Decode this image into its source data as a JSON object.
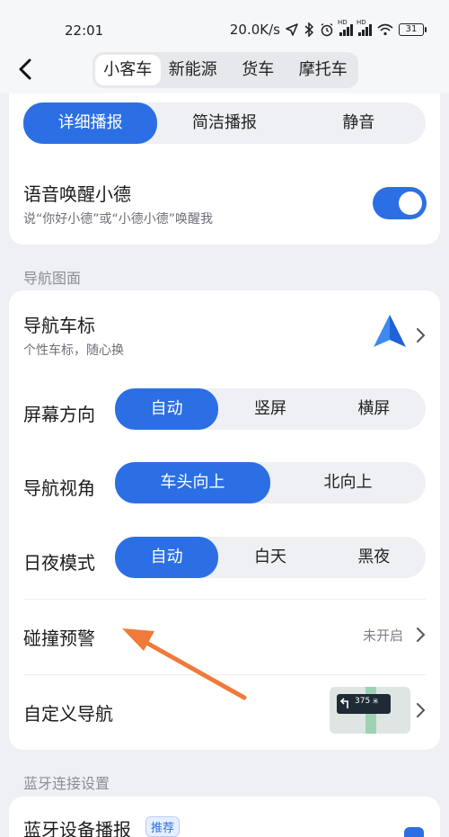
{
  "status_bar": {
    "time": "22:01",
    "net_speed": "20.0K/s",
    "hd1": "HD",
    "hd2": "HD",
    "battery": "31"
  },
  "header": {
    "vehicle_tabs": [
      "小客车",
      "新能源",
      "货车",
      "摩托车"
    ],
    "active_tab": 0
  },
  "broadcast_card": {
    "modes": [
      "详细播报",
      "简洁播报",
      "静音"
    ],
    "active_mode": 0,
    "wake": {
      "title": "语音唤醒小德",
      "subtitle": "说“你好小德”或“小德小德”唤醒我",
      "enabled": true
    }
  },
  "nav_section": {
    "label": "导航图面",
    "car_icon": {
      "title": "导航车标",
      "subtitle": "个性车标，随心换"
    },
    "screen_orientation": {
      "label": "屏幕方向",
      "options": [
        "自动",
        "竖屏",
        "横屏"
      ],
      "active": 0
    },
    "view_angle": {
      "label": "导航视角",
      "options": [
        "车头向上",
        "北向上"
      ],
      "active": 0
    },
    "day_night": {
      "label": "日夜模式",
      "options": [
        "自动",
        "白天",
        "黑夜"
      ],
      "active": 0
    },
    "collision": {
      "title": "碰撞预警",
      "status": "未开启"
    },
    "custom_nav": {
      "title": "自定义导航",
      "preview_number": "375",
      "preview_unit": "米"
    }
  },
  "bluetooth_section": {
    "label": "蓝牙连接设置",
    "device": {
      "title": "蓝牙设备播报",
      "badge": "推荐"
    }
  },
  "colors": {
    "accent": "#2c6fe4",
    "annotation_arrow": "#f07a3a"
  }
}
